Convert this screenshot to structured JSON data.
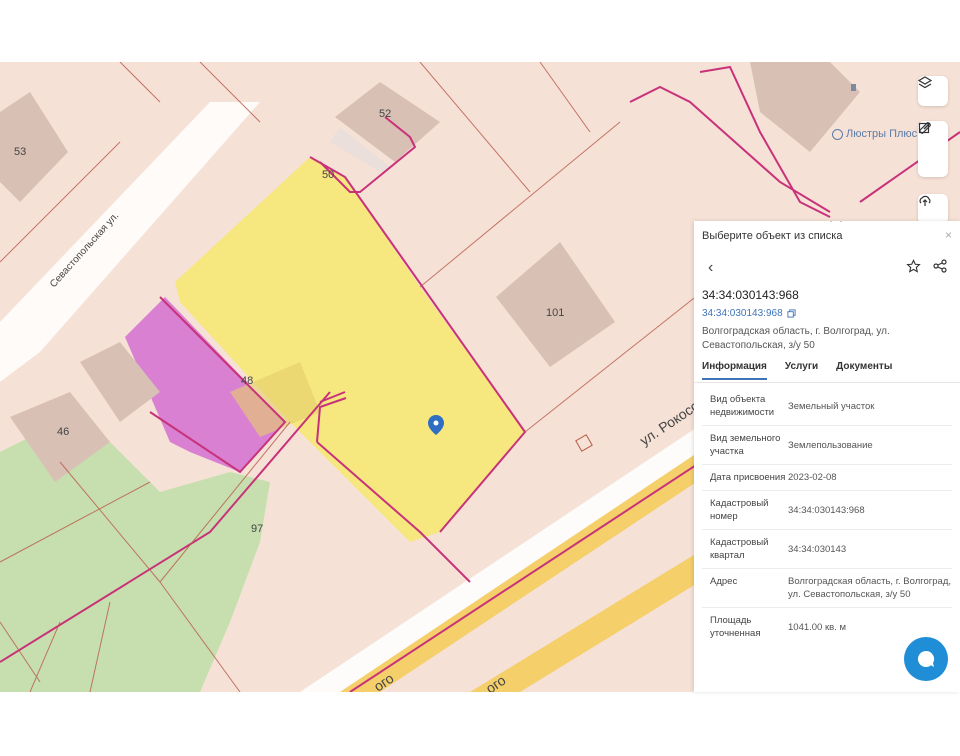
{
  "map": {
    "street_labels": [
      "Севастопольская ул.",
      "ул. Рокосс",
      "ого",
      "ого"
    ],
    "parcel_numbers": [
      "53",
      "52",
      "50",
      "101",
      "48",
      "46",
      "97"
    ],
    "poi_name": "Люстры Плюс"
  },
  "toolbar": {
    "layers_icon": "layers-icon",
    "ruler_icon": "ruler-icon",
    "edit_icon": "edit-icon",
    "upload_icon": "upload-icon"
  },
  "panel": {
    "header_title": "Выберите объект из списка",
    "close_glyph": "×",
    "back_glyph": "‹",
    "cadastral_number": "34:34:030143:968",
    "cadastral_link": "34:34:030143:968",
    "address_short": "Волгоградская область, г. Волгоград, ул. Севастопольская, з/у 50",
    "tabs": [
      "Информация",
      "Услуги",
      "Документы"
    ],
    "active_tab": 0,
    "rows": [
      {
        "key": "Вид объекта недвижимости",
        "value": "Земельный участок"
      },
      {
        "key": "Вид земельного участка",
        "value": "Землепользование"
      },
      {
        "key": "Дата присвоения",
        "value": "2023-02-08"
      },
      {
        "key": "Кадастровый номер",
        "value": "34:34:030143:968"
      },
      {
        "key": "Кадастровый квартал",
        "value": "34:34:030143"
      },
      {
        "key": "Адрес",
        "value": "Волгоградская область, г. Волгоград, ул. Севастопольская, з/у 50"
      },
      {
        "key": "Площадь уточненная",
        "value": "1041.00 кв. м"
      }
    ]
  },
  "colors": {
    "selected_parcel": "#f5e77a",
    "neighbor_parcel": "#d46fd2",
    "border_line": "#c8327a",
    "road": "#f4cf6a",
    "accent": "#3d74b8",
    "chat_button": "#1f8ed6"
  },
  "chat_icon": "chat-icon"
}
